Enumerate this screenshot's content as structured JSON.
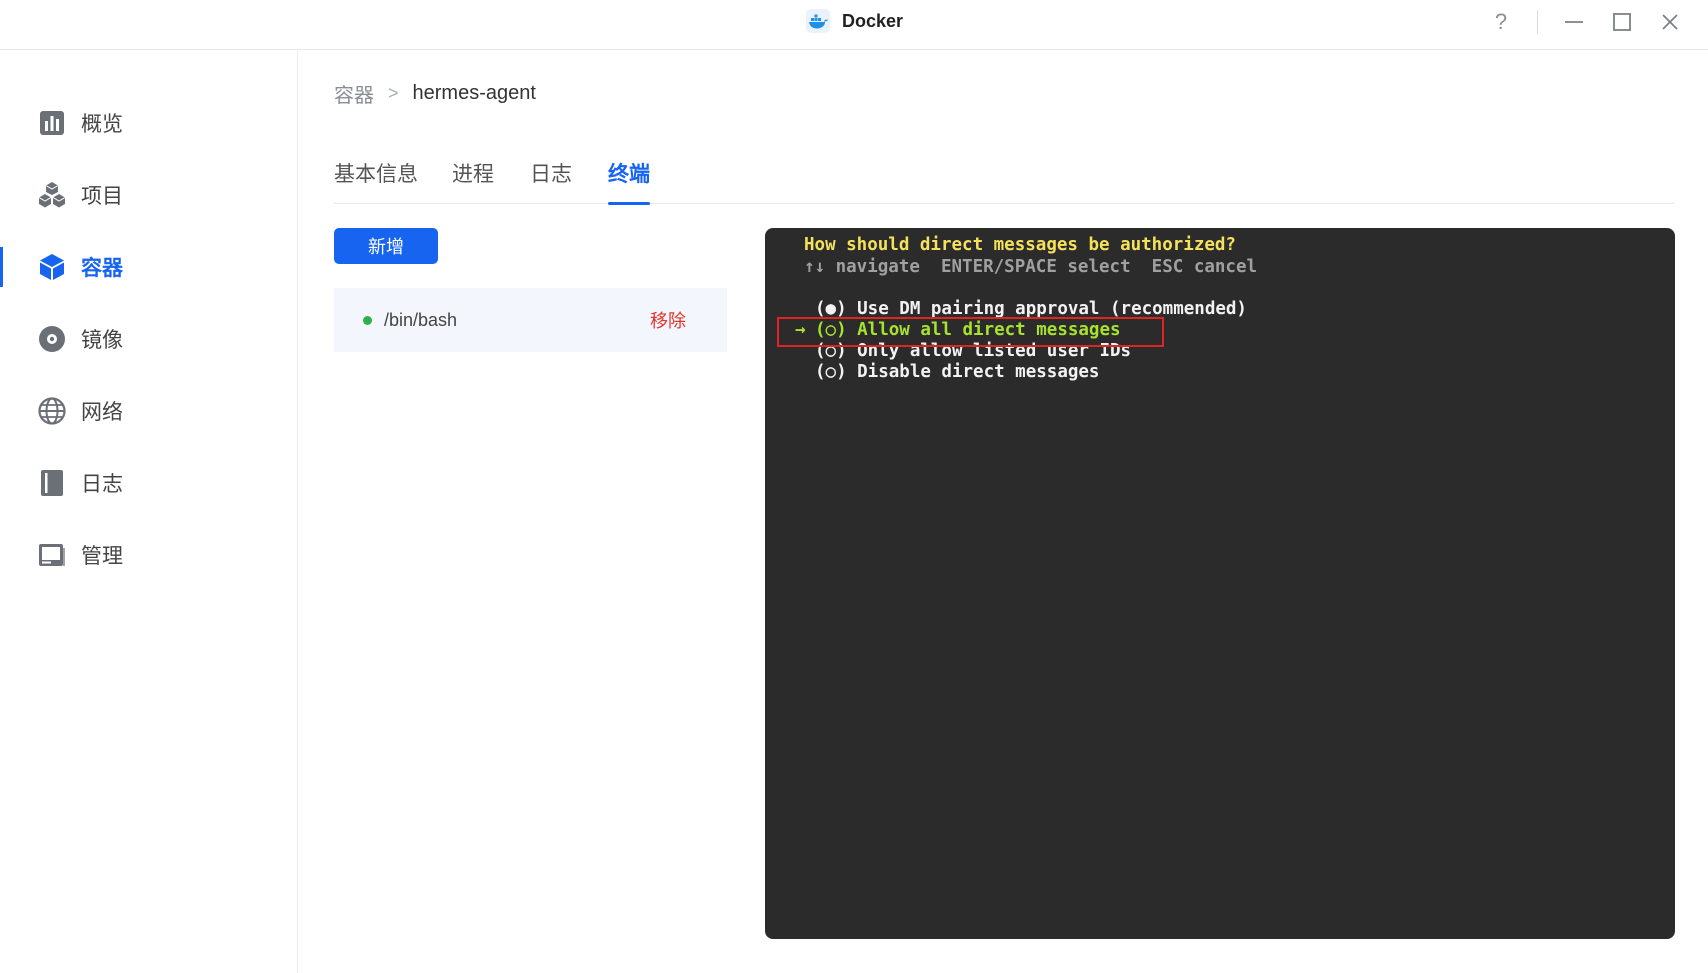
{
  "titlebar": {
    "title": "Docker",
    "help_label": "?"
  },
  "sidebar": {
    "items": [
      {
        "label": "概览",
        "icon": "bar-chart-icon"
      },
      {
        "label": "项目",
        "icon": "cubes-icon"
      },
      {
        "label": "容器",
        "icon": "container-icon",
        "active": true
      },
      {
        "label": "镜像",
        "icon": "disc-icon"
      },
      {
        "label": "网络",
        "icon": "globe-icon"
      },
      {
        "label": "日志",
        "icon": "book-icon"
      },
      {
        "label": "管理",
        "icon": "manage-icon"
      }
    ]
  },
  "breadcrumb": {
    "parent": "容器",
    "separator": ">",
    "current": "hermes-agent"
  },
  "tabs": [
    {
      "label": "基本信息"
    },
    {
      "label": "进程"
    },
    {
      "label": "日志"
    },
    {
      "label": "终端",
      "active": true
    }
  ],
  "actions": {
    "add_label": "新增"
  },
  "sessions": [
    {
      "label": "/bin/bash",
      "remove_label": "移除",
      "status_color": "#2db04a"
    }
  ],
  "terminal": {
    "prompt": "How should direct messages be authorized?",
    "hint": "↑↓ navigate  ENTER/SPACE select  ESC cancel",
    "options": [
      {
        "marker": " ",
        "text": "(●) Use DM pairing approval (recommended)"
      },
      {
        "marker": "→",
        "text": "(○) Allow all direct messages",
        "highlighted": true
      },
      {
        "marker": " ",
        "text": "(○) Only allow listed user IDs"
      },
      {
        "marker": " ",
        "text": "(○) Disable direct messages"
      }
    ]
  },
  "colors": {
    "accent": "#1664f0",
    "danger": "#e0352b",
    "terminal_bg": "#2b2b2b",
    "terminal_yellow": "#f5e15a",
    "terminal_green": "#a6e22e"
  }
}
